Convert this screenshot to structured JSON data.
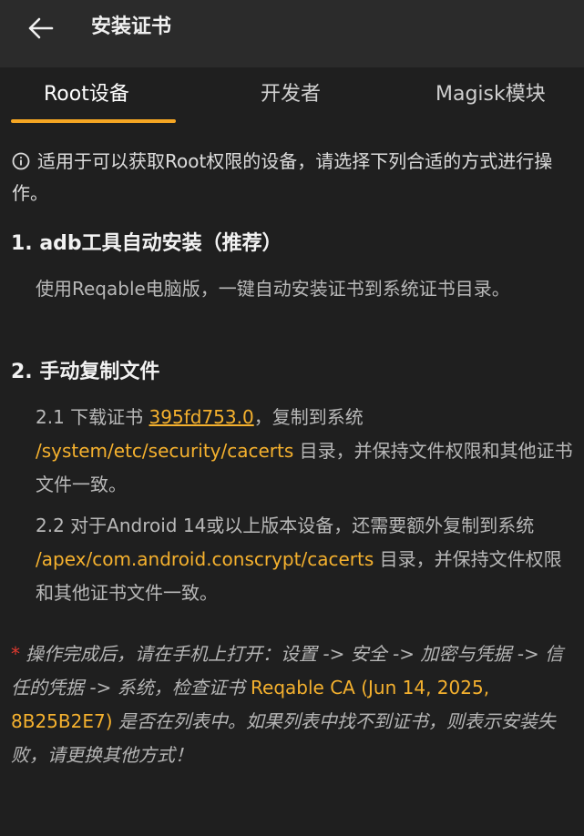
{
  "appbar": {
    "title": "安装证书"
  },
  "tabs": [
    {
      "label": "Root设备"
    },
    {
      "label": "开发者"
    },
    {
      "label": "Magisk模块"
    }
  ],
  "info": {
    "text": "适用于可以获取Root权限的设备，请选择下列合适的方式进行操作。"
  },
  "section1": {
    "title": "1. adb工具自动安装（推荐）",
    "desc": "使用Reqable电脑版，一键自动安装证书到系统证书目录。"
  },
  "section2": {
    "title": "2. 手动复制文件",
    "step1": {
      "prefix": "2.1 下载证书 ",
      "cert_link": "395fd753.0",
      "middle": "，复制到系统 ",
      "path": "/system/etc/security/cacerts",
      "suffix": " 目录，并保持文件权限和其他证书文件一致。"
    },
    "step2": {
      "prefix": "2.2 对于Android 14或以上版本设备，还需要额外复制到系统 ",
      "path": "/apex/com.android.conscrypt/cacerts",
      "suffix": " 目录，并保持文件权限和其他证书文件一致。"
    }
  },
  "note": {
    "star": "*",
    "prefix": "操作完成后，请在手机上打开：设置 -> 安全 -> 加密与凭据 -> 信任的凭据 -> 系统，检查证书 ",
    "cert_name": "Reqable CA (Jun 14, 2025, 8B25B2E7)",
    "suffix": " 是否在列表中。如果列表中找不到证书，则表示安装失败，请更换其他方式！"
  },
  "colors": {
    "accent": "#f5a623",
    "highlight": "#f5b12e",
    "warning": "#e03a2f"
  }
}
